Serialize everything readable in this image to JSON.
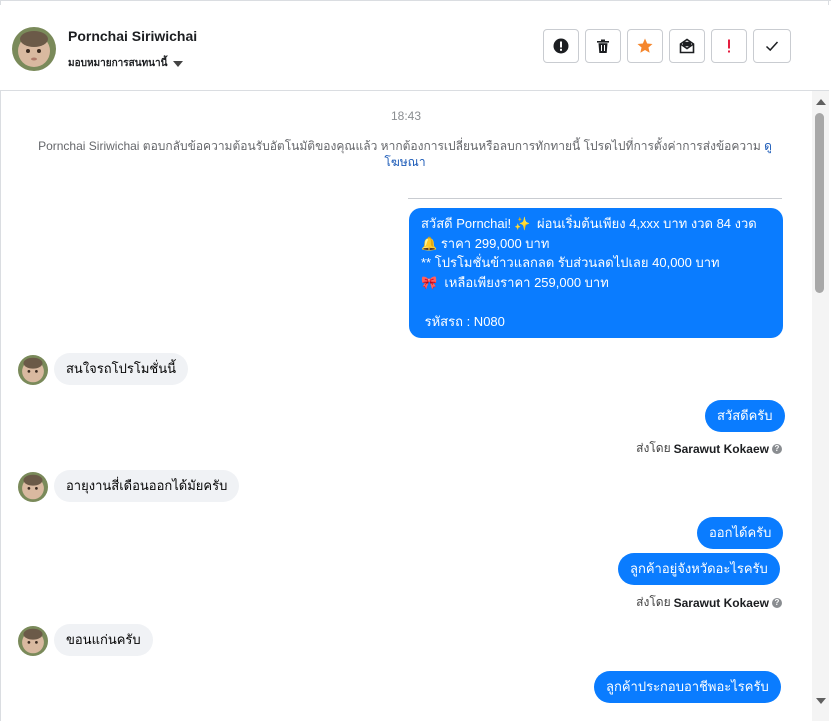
{
  "header": {
    "contact_name": "Pornchai Siriwichai",
    "assign_label": "มอบหมายการสนทนานี้",
    "actions": [
      {
        "name": "report-spam-button",
        "icon": "exclamation-circle-icon"
      },
      {
        "name": "delete-button",
        "icon": "trash-icon"
      },
      {
        "name": "star-button",
        "icon": "star-icon"
      },
      {
        "name": "mark-unread-button",
        "icon": "envelope-icon"
      },
      {
        "name": "important-button",
        "icon": "exclamation-icon"
      },
      {
        "name": "done-button",
        "icon": "check-icon"
      }
    ]
  },
  "thread": {
    "timestamp": "18:43",
    "notice_text": "Pornchai Siriwichai ตอบกลับข้อความต้อนรับอัตโนมัติของคุณแล้ว หากต้องการเปลี่ยนหรือลบการทักทายนี้ โปรดไปที่การตั้งค่าการส่งข้อความ",
    "notice_link_1": "ดู",
    "notice_link_2": "โฆษณา",
    "promo": {
      "line1": "สวัสดี Pornchai!",
      "line1_emoji": "✨",
      "line1_rest": "ผ่อนเริ่มต้นเพียง 4,xxx บาท งวด 84 งวด",
      "line2_emoji": "🔔",
      "line2": "ราคา 299,000 บาท",
      "line3": "** โปรโมชั่นข้าวแลกลด รับส่วนลดไปเลย 40,000 บาท",
      "line4_emoji": "🎀",
      "line4": "เหลือเพียงราคา 259,000 บาท",
      "line5": "รหัสรถ : N080"
    },
    "messages": [
      {
        "text": "สนใจรถโปรโมชั่นนี้"
      },
      {
        "text": "สวัสดีครับ"
      },
      {
        "text": "อายุงานสี่เดือนออกได้มัยครับ"
      },
      {
        "text": "ออกได้ครับ"
      },
      {
        "text": "ลูกค้าอยู่จังหวัดอะไรครับ"
      },
      {
        "text": "ขอนแก่นครับ"
      },
      {
        "text": "ลูกค้าประกอบอาชีพอะไรครับ"
      }
    ],
    "sent_by_prefix": "ส่งโดย",
    "sent_by_name": "Sarawut Kokaew",
    "help_glyph": "?"
  },
  "colors": {
    "outgoing_bubble": "#0a7cff",
    "incoming_bubble": "#f0f2f5",
    "star": "#f5862d",
    "important": "#e41e3f"
  }
}
